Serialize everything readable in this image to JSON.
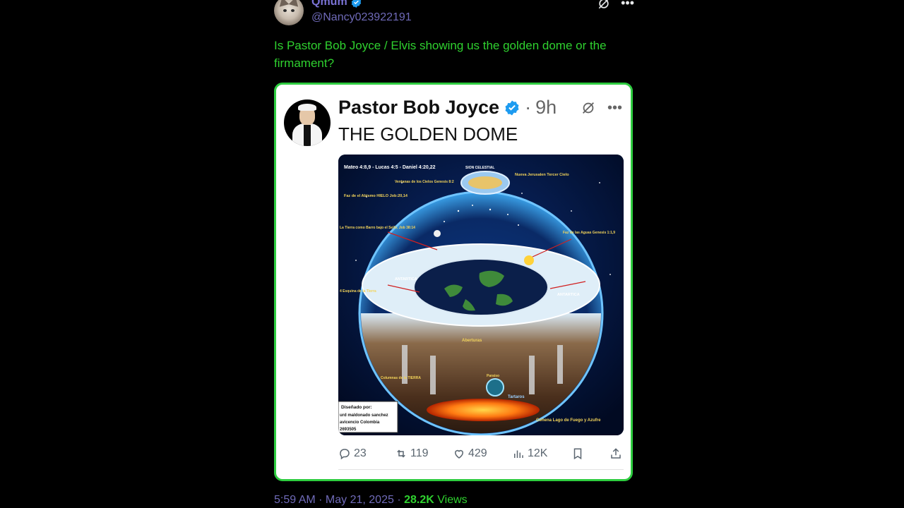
{
  "post": {
    "display_name": "Qmum",
    "handle": "@Nancy023922191",
    "text": "Is Pastor Bob Joyce / Elvis showing us the golden dome or the firmament?",
    "timestamp": "5:59 AM · May 21, 2025",
    "views_count": "28.2K",
    "views_label": "Views",
    "separator": "·"
  },
  "quoted": {
    "display_name": "Pastor Bob Joyce",
    "time_sep": "·",
    "time": "9h",
    "text": "THE GOLDEN DOME",
    "image_labels": {
      "top_refs": "Mateo 4:8,9 - Lucas 4:5 - Daniel 4:20,22",
      "sion": "SION CELESTIAL",
      "nueva_jerusalen": "Nueva Jerusalen Tercer Cielo",
      "ventanas": "Ventanas de los Cielos Genesis 8:2",
      "faz_abismo": "Faz de el Abismo HIELO Job:20,14",
      "tierra_barro": "La Tierra como Barro bajo el Sello. Job 38:14",
      "faz_aguas": "Faz de las Aguas Genesis 1:1,9",
      "antartica": "ANTARTICA",
      "esquina": "4 Esquina de la Tierra",
      "aberturas": "Aberturas",
      "columnas": "Columnas de la TIERRA",
      "tartaros": "Tartaros",
      "paraiso": "Paraiso",
      "gehena": "Gehena Lago de Fuego y Azufre",
      "disenado": "Diseñado por:",
      "credit_1": "urd maldonado sanchez",
      "credit_2": "avicencio Colombia",
      "credit_3": "2693505"
    },
    "actions": {
      "replies": "23",
      "reposts": "119",
      "likes": "429",
      "views": "12K"
    }
  },
  "colors": {
    "accent_green": "#2fd12f",
    "name_purple": "#7b73d6",
    "verified_blue": "#1d9bf0"
  }
}
